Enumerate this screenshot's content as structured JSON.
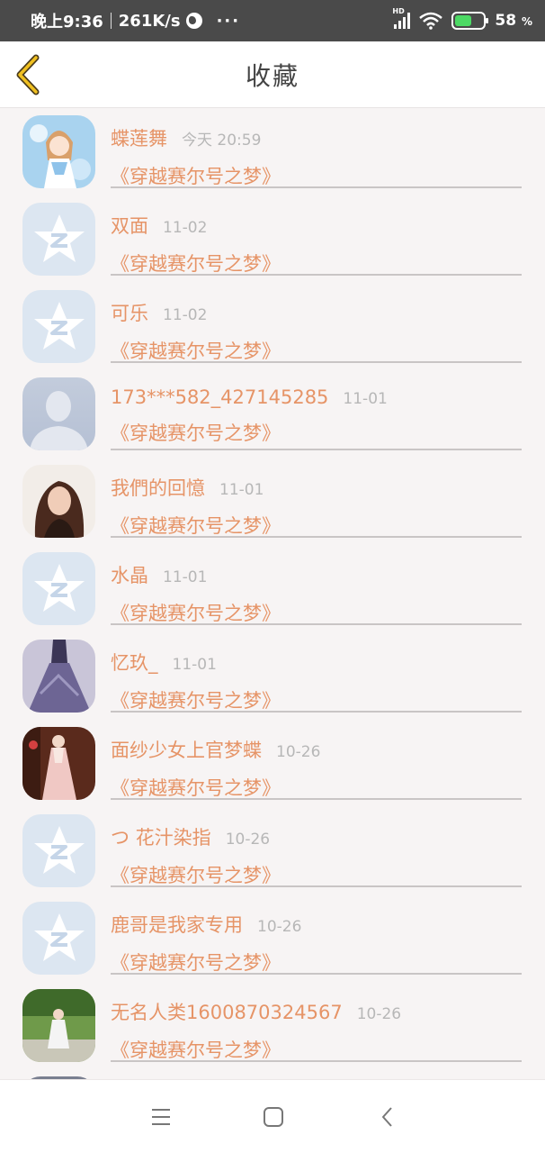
{
  "status_bar": {
    "time": "晚上9:36",
    "speed": "261K/s",
    "more": "···",
    "signal_tag": "HD",
    "battery": "58",
    "battery_unit": "%"
  },
  "header": {
    "title": "收藏"
  },
  "items": [
    {
      "name": "蝶莲舞",
      "time": "今天 20:59",
      "snippet": "《穿越赛尔号之梦》",
      "avatar": "anime-girl-photo"
    },
    {
      "name": "双面",
      "time": "11-02",
      "snippet": "《穿越赛尔号之梦》",
      "avatar": "default-qq-star"
    },
    {
      "name": "可乐",
      "time": "11-02",
      "snippet": "《穿越赛尔号之梦》",
      "avatar": "default-qq-star"
    },
    {
      "name": "173***582_427145285",
      "time": "11-01",
      "snippet": "《穿越赛尔号之梦》",
      "avatar": "default-person-silhouette"
    },
    {
      "name": "我們的回憶",
      "time": "11-01",
      "snippet": "《穿越赛尔号之梦》",
      "avatar": "woman-portrait-photo"
    },
    {
      "name": "水晶",
      "time": "11-01",
      "snippet": "《穿越赛尔号之梦》",
      "avatar": "default-qq-star"
    },
    {
      "name": "忆玖_",
      "time": "11-01",
      "snippet": "《穿越赛尔号之梦》",
      "avatar": "purple-dress-photo"
    },
    {
      "name": "面纱少女上官梦蝶",
      "time": "10-26",
      "snippet": "《穿越赛尔号之梦》",
      "avatar": "hanfu-girl-photo"
    },
    {
      "name": "つ 花汁染指",
      "time": "10-26",
      "snippet": "《穿越赛尔号之梦》",
      "avatar": "default-qq-star"
    },
    {
      "name": "鹿哥是我家专用",
      "time": "10-26",
      "snippet": "《穿越赛尔号之梦》",
      "avatar": "default-qq-star"
    },
    {
      "name": "无名人类1600870324567",
      "time": "10-26",
      "snippet": "《穿越赛尔号之梦》",
      "avatar": "garden-girl-photo"
    }
  ],
  "nav": {
    "icons": [
      "menu-icon",
      "home-square-icon",
      "back-triangle-icon"
    ]
  },
  "colors": {
    "accent": "#e69467",
    "time_gray": "#b7b7b7",
    "back_arrow": "#f0c020"
  }
}
